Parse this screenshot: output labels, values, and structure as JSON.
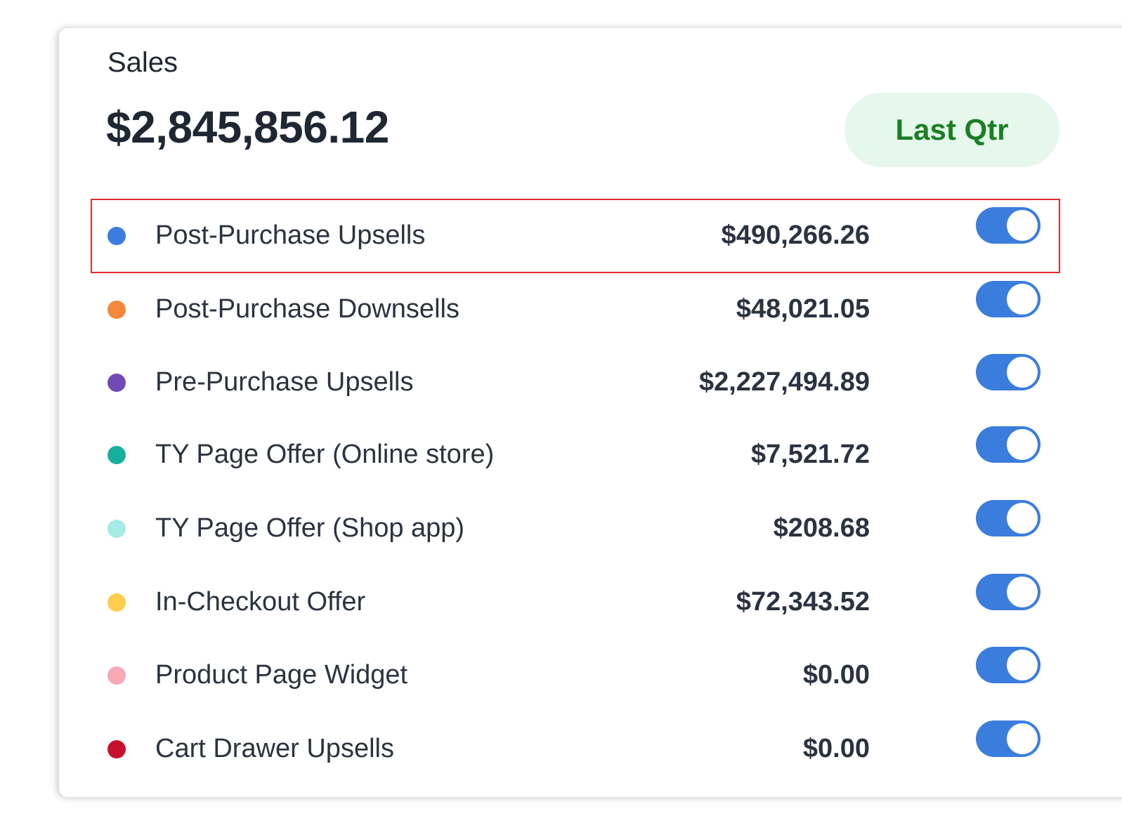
{
  "card": {
    "title": "Sales",
    "total": "$2,845,856.12",
    "period_button": "Last Qtr"
  },
  "rows": [
    {
      "label": "Post-Purchase Upsells",
      "value": "$490,266.26",
      "color": "#3b7ddd",
      "enabled": true,
      "highlighted": true
    },
    {
      "label": "Post-Purchase Downsells",
      "value": "$48,021.05",
      "color": "#f5873a",
      "enabled": true,
      "highlighted": false
    },
    {
      "label": "Pre-Purchase Upsells",
      "value": "$2,227,494.89",
      "color": "#6f4bb5",
      "enabled": true,
      "highlighted": false
    },
    {
      "label": "TY Page Offer (Online store)",
      "value": "$7,521.72",
      "color": "#17b09c",
      "enabled": true,
      "highlighted": false
    },
    {
      "label": "TY Page Offer (Shop app)",
      "value": "$208.68",
      "color": "#a6ebe6",
      "enabled": true,
      "highlighted": false
    },
    {
      "label": "In-Checkout Offer",
      "value": "$72,343.52",
      "color": "#ffcc4d",
      "enabled": true,
      "highlighted": false
    },
    {
      "label": "Product Page Widget",
      "value": "$0.00",
      "color": "#f7a9b6",
      "enabled": true,
      "highlighted": false
    },
    {
      "label": "Cart Drawer Upsells",
      "value": "$0.00",
      "color": "#c8102e",
      "enabled": true,
      "highlighted": false
    }
  ],
  "colors": {
    "toggle_on": "#3b7ddd",
    "highlight_border": "#e02b2b",
    "pill_background": "#e6f7ec",
    "pill_text": "#1a7f23"
  }
}
